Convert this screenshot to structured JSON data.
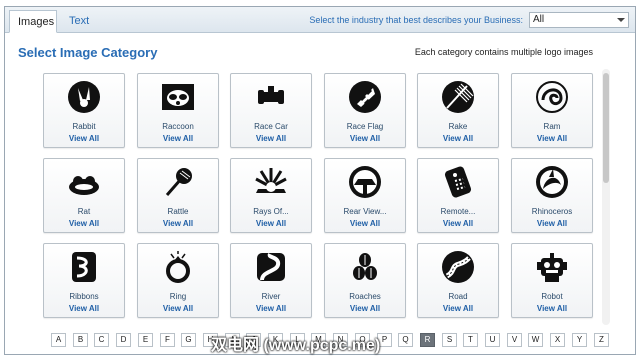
{
  "tabs": [
    {
      "label": "Images",
      "active": true
    },
    {
      "label": "Text",
      "active": false
    }
  ],
  "industry": {
    "label": "Select the industry that best describes your Business:",
    "selected": "All"
  },
  "header": {
    "title": "Select Image Category",
    "note": "Each category contains multiple logo images"
  },
  "view_all_label": "View All",
  "categories": [
    {
      "name": "Rabbit",
      "icon": "rabbit-icon"
    },
    {
      "name": "Raccoon",
      "icon": "raccoon-icon"
    },
    {
      "name": "Race Car",
      "icon": "race-car-icon"
    },
    {
      "name": "Race Flag",
      "icon": "race-flag-icon"
    },
    {
      "name": "Rake",
      "icon": "rake-icon"
    },
    {
      "name": "Ram",
      "icon": "ram-icon"
    },
    {
      "name": "Rat",
      "icon": "rat-icon"
    },
    {
      "name": "Rattle",
      "icon": "rattle-icon"
    },
    {
      "name": "Rays Of...",
      "icon": "rays-icon"
    },
    {
      "name": "Rear View...",
      "icon": "rear-view-icon"
    },
    {
      "name": "Remote...",
      "icon": "remote-icon"
    },
    {
      "name": "Rhinoceros",
      "icon": "rhinoceros-icon"
    },
    {
      "name": "Ribbons",
      "icon": "ribbons-icon"
    },
    {
      "name": "Ring",
      "icon": "ring-icon"
    },
    {
      "name": "River",
      "icon": "river-icon"
    },
    {
      "name": "Roaches",
      "icon": "roaches-icon"
    },
    {
      "name": "Road",
      "icon": "road-icon"
    },
    {
      "name": "Robot",
      "icon": "robot-icon"
    }
  ],
  "alphabet": {
    "letters": [
      "A",
      "B",
      "C",
      "D",
      "E",
      "F",
      "G",
      "H",
      "I",
      "J",
      "K",
      "L",
      "M",
      "N",
      "O",
      "P",
      "Q",
      "R",
      "S",
      "T",
      "U",
      "V",
      "W",
      "X",
      "Y",
      "Z"
    ],
    "active": "R"
  },
  "watermark": "双电网 (www.pcpc.me)"
}
